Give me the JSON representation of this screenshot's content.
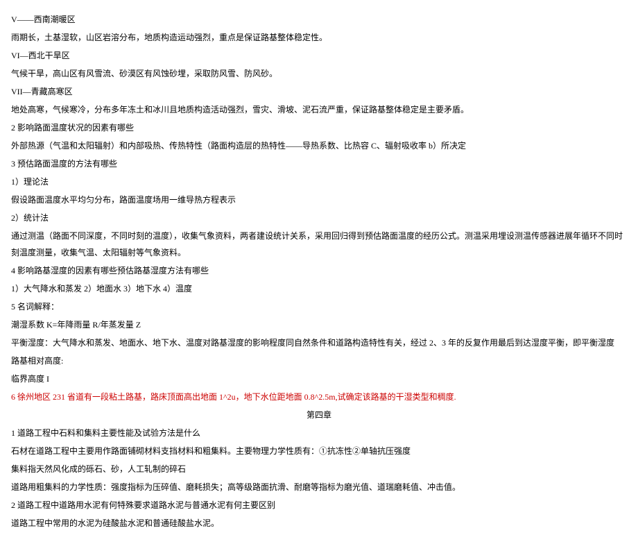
{
  "lines": [
    {
      "text": "V——西南潮暖区",
      "cls": ""
    },
    {
      "text": "雨期长，土基湿软，山区岩溶分布，地质构造运动强烈，重点是保证路基整体稳定性。",
      "cls": ""
    },
    {
      "text": "VI—西北干旱区",
      "cls": ""
    },
    {
      "text": "气候干旱，高山区有风雪流、砂漠区有风蚀砂埋，采取防风雪、防风砂。",
      "cls": ""
    },
    {
      "text": "VII—青藏高寒区",
      "cls": ""
    },
    {
      "text": "地处高寒，气候寒冷，分布多年冻土和冰川且地质构造活动强烈，雪灾、滑坡、泥石流严重，保证路基整体稳定是主要矛盾。",
      "cls": ""
    },
    {
      "text": "2 影响路面温度状况的因素有哪些",
      "cls": ""
    },
    {
      "text": "外部热源（气温和太阳辐射）和内部吸热、传热特性（路面构造层的热特性——导热系数、比热容 C、辐射吸收率 b）所决定",
      "cls": ""
    },
    {
      "text": "3 预估路面温度的方法有哪些",
      "cls": ""
    },
    {
      "text": "1）理论法",
      "cls": ""
    },
    {
      "text": "假设路面温度水平均匀分布，路面温度场用一维导热方程表示",
      "cls": ""
    },
    {
      "text": "2）统计法",
      "cls": ""
    },
    {
      "text": "通过测温（路面不同深度，不同时刻的温度），收集气象资料，两者建设统计关系，采用回归得到预估路面温度的经历公式。测温采用埋设测温传感器进展年循环不同时刻温度测量，收集气温、太阳辐射等气象资料。",
      "cls": ""
    },
    {
      "text": "4 影响路基湿度的因素有哪些预估路基湿度方法有哪些",
      "cls": ""
    },
    {
      "text": "1）大气降水和蒸发 2）地面水 3）地下水 4）温度",
      "cls": ""
    },
    {
      "text": "5 名词解释：",
      "cls": ""
    },
    {
      "text": "潮湿系数 K=年降雨量 R/年蒸发量 Z",
      "cls": ""
    },
    {
      "text": "平衡湿度：大气降水和蒸发、地面水、地下水、温度对路基湿度的影响程度同自然条件和道路构造特性有关，经过 2、3 年的反复作用最后到达湿度平衡，即平衡湿度",
      "cls": ""
    },
    {
      "text": "路基相对高度:",
      "cls": ""
    },
    {
      "text": "临界高度 I",
      "cls": ""
    },
    {
      "text": "6 徐州地区 231 省道有一段粘土路基，路床顶面高出地面 1^2u，地下水位距地面 0.8^2.5m,试确定该路基的干湿类型和稠度.",
      "cls": "red"
    },
    {
      "text": "第四章",
      "cls": "chapter"
    },
    {
      "text": "1 道路工程中石料和集料主要性能及试验方法是什么",
      "cls": ""
    },
    {
      "text": "石材在道路工程中主要用作路面铺砌材料支挡材料和粗集料。主要物理力学性质有：①抗冻性②单轴抗压强度",
      "cls": ""
    },
    {
      "text": "集料指天然风化成的砾石、砂，人工轧制的碎石",
      "cls": ""
    },
    {
      "text": "道路用粗集料的力学性质：强度指标为压碎值、磨耗损失；高等级路面抗滑、耐磨等指标为磨光值、道瑞磨耗值、冲击值。",
      "cls": ""
    },
    {
      "text": "2 道路工程中道路用水泥有何特殊要求道路水泥与普通水泥有何主要区别",
      "cls": ""
    },
    {
      "text": "道路工程中常用的水泥为硅酸盐水泥和普通硅酸盐水泥。",
      "cls": ""
    }
  ]
}
